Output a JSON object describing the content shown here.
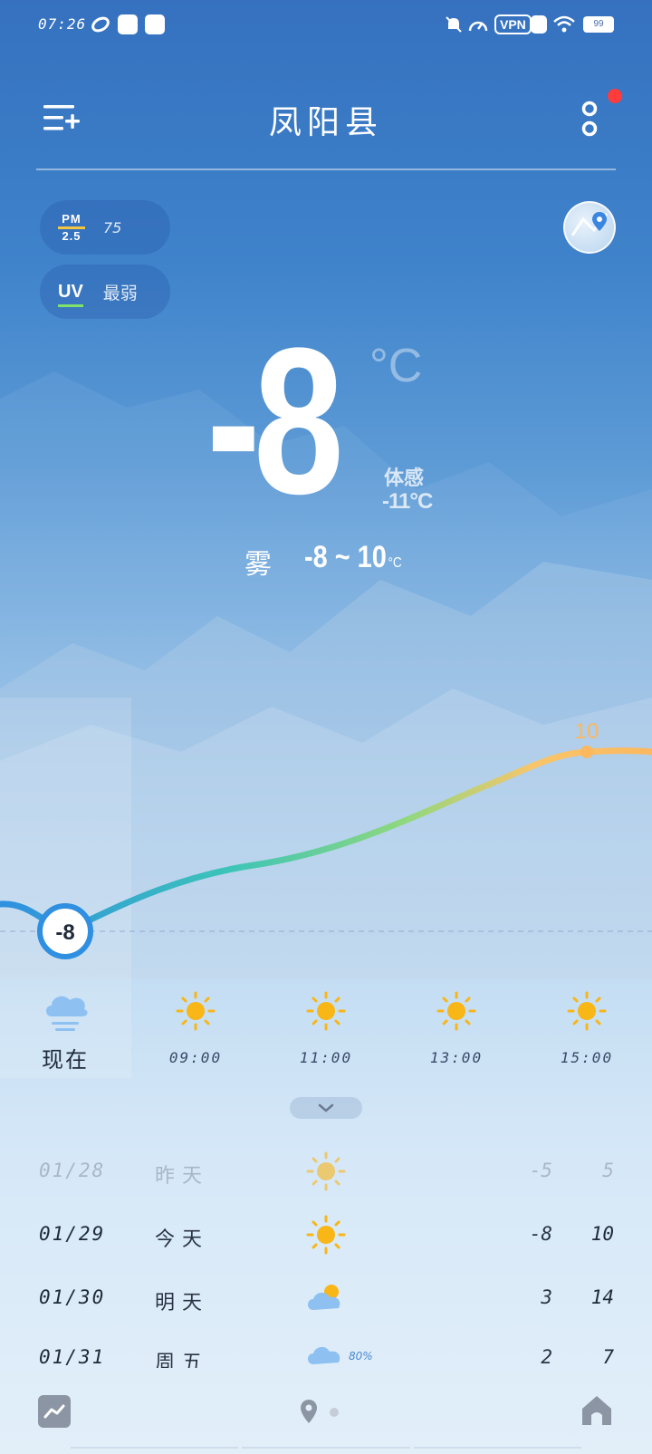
{
  "status_bar": {
    "time": "07:26",
    "vpn": "VPN",
    "battery": "99",
    "icons": [
      "app-icon",
      "baidu-icon",
      "shop-icon",
      "mute-icon",
      "speed-icon",
      "vpn-icon",
      "close-box-icon",
      "wifi-icon",
      "battery-icon"
    ]
  },
  "header": {
    "city": "凤阳县",
    "menu_icon": "menu-add-icon",
    "more_icon": "more-icon",
    "notification_dot_color": "#ff3b3b"
  },
  "pills": {
    "pm_label_top": "PM",
    "pm_label_bottom": "2.5",
    "pm_value": "75",
    "uv_label": "UV",
    "uv_value": "最弱"
  },
  "current": {
    "temp": "-8",
    "unit": "°C",
    "feels_label": "体感",
    "feels_value": "-11°C",
    "condition": "雾",
    "range": "-8 ~ 10",
    "range_unit": "°C"
  },
  "chart": {
    "now_value": "-8",
    "max_value": "10",
    "line_colors": [
      "#2f8fe0",
      "#3cc4b8",
      "#8fd87e",
      "#f9c56a",
      "#fbb85e"
    ]
  },
  "hourly": [
    {
      "label": "现在",
      "icon": "fog-icon"
    },
    {
      "label": "09:00",
      "icon": "sun-icon"
    },
    {
      "label": "11:00",
      "icon": "sun-icon"
    },
    {
      "label": "13:00",
      "icon": "sun-icon"
    },
    {
      "label": "15:00",
      "icon": "sun-icon"
    }
  ],
  "daily": [
    {
      "date": "01/28",
      "name": "昨天",
      "icon": "sun-icon",
      "precip": "",
      "low": "-5",
      "high": "5"
    },
    {
      "date": "01/29",
      "name": "今天",
      "icon": "sun-icon",
      "precip": "",
      "low": "-8",
      "high": "10"
    },
    {
      "date": "01/30",
      "name": "明天",
      "icon": "partly-cloudy-icon",
      "precip": "",
      "low": "3",
      "high": "14"
    },
    {
      "date": "01/31",
      "name": "周五",
      "icon": "cloud-icon",
      "precip": "80%",
      "low": "2",
      "high": "7"
    }
  ],
  "colors": {
    "sun": "#f8b617",
    "accent": "#2f8fe0",
    "warm": "#fbb85e"
  }
}
